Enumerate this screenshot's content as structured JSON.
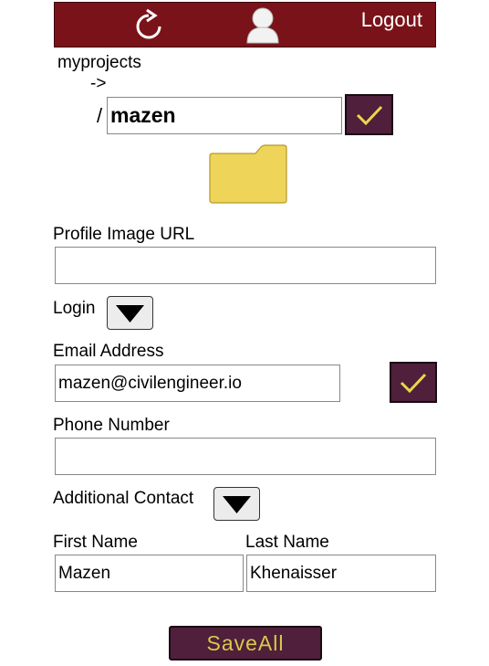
{
  "header": {
    "logout_label": "Logout"
  },
  "breadcrumb": {
    "root": "myprojects",
    "arrow": "->",
    "slash": "/",
    "project_name_value": "mazen"
  },
  "form": {
    "profile_image_label": "Profile Image URL",
    "profile_image_value": "",
    "login_label": "Login",
    "email_label": "Email Address",
    "email_value": "mazen@civilengineer.io",
    "phone_label": "Phone Number",
    "phone_value": "",
    "additional_contact_label": "Additional Contact",
    "first_name_label": "First Name",
    "first_name_value": "Mazen",
    "last_name_label": "Last Name",
    "last_name_value": "Khenaisser",
    "save_label": "SaveAll"
  },
  "colors": {
    "header_bg": "#7a1319",
    "button_bg": "#4f1f3b",
    "check_color": "#e8d84a",
    "folder_color": "#efd45a"
  },
  "icons": [
    "refresh-icon",
    "user-icon",
    "check-icon",
    "folder-icon",
    "triangle-down-icon"
  ]
}
